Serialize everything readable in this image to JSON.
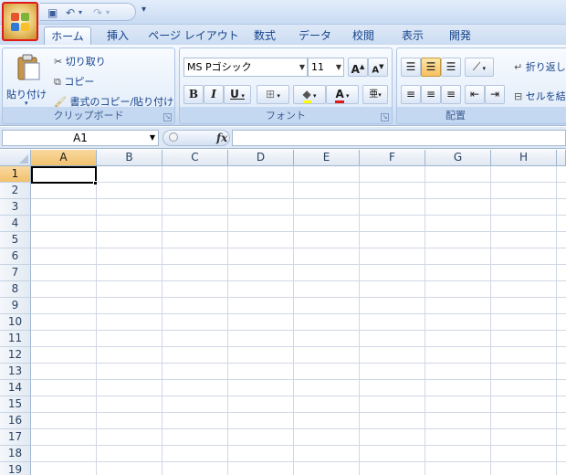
{
  "tabs": [
    {
      "label": "ホーム",
      "active": true
    },
    {
      "label": "挿入"
    },
    {
      "label": "ページ レイアウト"
    },
    {
      "label": "数式"
    },
    {
      "label": "データ"
    },
    {
      "label": "校閲"
    },
    {
      "label": "表示"
    },
    {
      "label": "開発"
    }
  ],
  "clipboard": {
    "paste": "貼り付け",
    "cut": "切り取り",
    "copy": "コピー",
    "format_painter": "書式のコピー/貼り付け",
    "label": "クリップボード"
  },
  "font": {
    "name": "MS Pゴシック",
    "size": "11",
    "bold": "B",
    "italic": "I",
    "underline": "U",
    "grow": "A",
    "shrink": "A",
    "color_letter": "A",
    "label": "フォント"
  },
  "alignment": {
    "wrap_text": "折り返し",
    "merge": "セルを結",
    "label": "配置"
  },
  "namebox": {
    "value": "A1"
  },
  "formula": {
    "fx": "fx",
    "value": ""
  },
  "sheet": {
    "columns": [
      "A",
      "B",
      "C",
      "D",
      "E",
      "F",
      "G",
      "H"
    ],
    "rows": [
      "1",
      "2",
      "3",
      "4",
      "5",
      "6",
      "7",
      "8",
      "9",
      "10",
      "11",
      "12",
      "13",
      "14",
      "15",
      "16",
      "17",
      "18",
      "19"
    ],
    "selected_cell": "A1"
  },
  "colors": {
    "accent": "#f1c16c",
    "ribbon": "#dde8f6",
    "highlight_red": "#e01a1a"
  }
}
